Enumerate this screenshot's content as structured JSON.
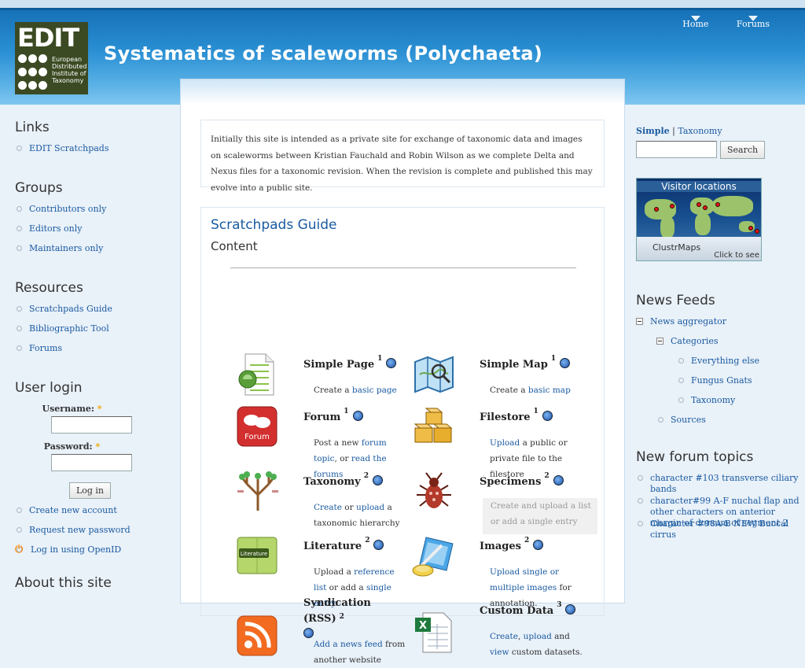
{
  "site": {
    "name": "Systematics of scaleworms (Polychaeta)",
    "logo": {
      "word": "EDIT",
      "sub": [
        "European",
        "Distributed",
        "Institute of",
        "Taxonomy"
      ]
    }
  },
  "top_nav": [
    "Home",
    "Forums"
  ],
  "left": {
    "links": {
      "title": "Links",
      "items": [
        "EDIT Scratchpads"
      ]
    },
    "groups": {
      "title": "Groups",
      "items": [
        "Contributors only",
        "Editors only",
        "Maintainers only"
      ]
    },
    "resources": {
      "title": "Resources",
      "items": [
        "Scratchpads Guide",
        "Bibliographic Tool",
        "Forums"
      ]
    },
    "login": {
      "title": "User login",
      "username_label": "Username:",
      "password_label": "Password:",
      "required_mark": "*",
      "button": "Log in",
      "links": [
        "Create new account",
        "Request new password",
        "Log in using OpenID"
      ]
    },
    "about_title": "About this site"
  },
  "main": {
    "intro": "Initially this site is intended as a private site for exchange of taxonomic data and images on scaleworms between Kristian Fauchald and Robin Wilson as we complete Delta and Nexus files for a taxonomic revision. When the revision is complete and published this may evolve into a public site.",
    "guide_title": "Scratchpads Guide",
    "content_title": "Content",
    "items": [
      {
        "name": "Simple Page",
        "sup": "1",
        "desc": [
          {
            "t": "Create a "
          },
          {
            "l": "basic page"
          }
        ]
      },
      {
        "name": "Simple Map",
        "sup": "1",
        "desc": [
          {
            "t": "Create a "
          },
          {
            "l": "basic map"
          }
        ]
      },
      {
        "name": "Forum",
        "sup": "1",
        "icon_label": "Forum",
        "desc": [
          {
            "t": "Post a new "
          },
          {
            "l": "forum topic"
          },
          {
            "t": ", or "
          },
          {
            "l": "read the forums"
          }
        ]
      },
      {
        "name": "Filestore",
        "sup": "1",
        "desc": [
          {
            "l": "Upload"
          },
          {
            "t": " a public or private file to the filestore"
          }
        ]
      },
      {
        "name": "Taxonomy",
        "sup": "2",
        "desc": [
          {
            "l": "Create"
          },
          {
            "t": " or "
          },
          {
            "l": "upload"
          },
          {
            "t": " a taxonomic hierarchy"
          }
        ]
      },
      {
        "name": "Specimens",
        "sup": "2",
        "disabled_desc": "Create and upload a list or add a single entry"
      },
      {
        "name": "Literature",
        "sup": "2",
        "icon_label": "Literature",
        "desc": [
          {
            "t": "Upload a "
          },
          {
            "l": "reference list"
          },
          {
            "t": " or add a "
          },
          {
            "l": "single entry"
          },
          {
            "t": "."
          }
        ]
      },
      {
        "name": "Images",
        "sup": "2",
        "desc": [
          {
            "l": "Upload single or multiple images"
          },
          {
            "t": " for annotation."
          }
        ]
      },
      {
        "name": "Syndication (RSS)",
        "sup": "2",
        "desc": [
          {
            "l": "Add a news feed"
          },
          {
            "t": " from another website"
          }
        ]
      },
      {
        "name": "Custom Data",
        "sup": "3",
        "desc": [
          {
            "l": "Create"
          },
          {
            "t": ", "
          },
          {
            "l": "upload"
          },
          {
            "t": " and "
          },
          {
            "l": "view"
          },
          {
            "t": " custom datasets."
          }
        ]
      }
    ]
  },
  "right": {
    "search": {
      "tab_active": "Simple",
      "tab_sep": "|",
      "tab_other": "Taxonomy",
      "button": "Search"
    },
    "clustr": {
      "title": "Visitor locations",
      "brand": "ClustrMaps",
      "click": "Click to see"
    },
    "news": {
      "title": "News Feeds",
      "aggregator": "News aggregator",
      "categories": "Categories",
      "category_items": [
        "Everything else",
        "Fungus Gnats",
        "Taxonomy"
      ],
      "sources": "Sources"
    },
    "forum": {
      "title": "New forum topics",
      "topics": [
        "character #103 transverse ciliary bands",
        "character#99 A-F nuchal flap and other characters on anterior margin of dorsum of segment 2",
        "Character #98A-B NEW Buccal cirrus"
      ]
    }
  },
  "colors": {
    "link": "#1a5aa0",
    "header": "#2a8fd3",
    "required": "#f1a600"
  }
}
